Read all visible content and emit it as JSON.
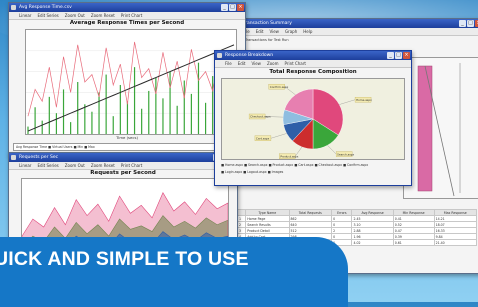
{
  "banner": {
    "text": "UICK AND SIMPLE TO USE"
  },
  "windows": {
    "avg_response": {
      "title": "Avg Response Time.csv",
      "menu": [
        "Linear",
        "Edit Series",
        "Zoom Out",
        "Zoom Reset",
        "Print Chart"
      ],
      "chart_title": "Average Response Times per Second",
      "xlabel": "Time (secs)",
      "legend": "Avg Response Time  ■ Virtual Users  ■ Min  ■ Max"
    },
    "requests": {
      "title": "Requests per Sec",
      "menu": [
        "Linear",
        "Edit Series",
        "Zoom Out",
        "Zoom Reset",
        "Print Chart"
      ],
      "chart_title": "Requests per Second",
      "legend": "Req/Sec  ■ Errors  ■ Virtual Users"
    },
    "transactions": {
      "title": "Transaction Summary",
      "menu": [
        "File",
        "Edit",
        "View",
        "Graph",
        "Help"
      ],
      "toolbar_label": "Test Transactions for Test Run",
      "columns": [
        "",
        "Type Name",
        "Total Requests",
        "Errors",
        "Avg Response",
        "Min Response",
        "Max Response"
      ],
      "rows": [
        [
          "1",
          "Home Page",
          "862",
          "0",
          "2.45",
          "0.41",
          "14.21"
        ],
        [
          "2",
          "Search Results",
          "640",
          "0",
          "3.10",
          "0.52",
          "18.07"
        ],
        [
          "3",
          "Product Detail",
          "512",
          "2",
          "2.88",
          "0.47",
          "16.33"
        ],
        [
          "4",
          "Add to Cart",
          "298",
          "0",
          "1.96",
          "0.39",
          "9.84"
        ],
        [
          "5",
          "Checkout",
          "174",
          "1",
          "4.02",
          "0.61",
          "21.40"
        ]
      ]
    },
    "response_breakdown": {
      "title": "Response Breakdown",
      "menu": [
        "File",
        "Edit",
        "View",
        "Zoom",
        "Print Chart"
      ],
      "chart_title": "Total Response Composition",
      "legend_line1": "■ Home.aspx  ■ Search.aspx  ■ Product.aspx  ■ Cart.aspx  ■ Checkout.aspx  ■ Confirm.aspx",
      "legend_line2": "■ Login.aspx  ■ Logout.aspx  ■ Images"
    }
  },
  "chart_data": [
    {
      "type": "pie",
      "title": "Total Response Composition",
      "slices": [
        {
          "label": "Home.aspx",
          "value": 34,
          "color": "#e0487c"
        },
        {
          "label": "Search.aspx",
          "value": 16,
          "color": "#3aa63a"
        },
        {
          "label": "Product.aspx",
          "value": 12,
          "color": "#cc2d2d"
        },
        {
          "label": "Cart.aspx",
          "value": 10,
          "color": "#2e5fa8"
        },
        {
          "label": "Checkout.aspx",
          "value": 8,
          "color": "#8fbde0"
        },
        {
          "label": "Confirm.aspx",
          "value": 20,
          "color": "#e77fb0"
        }
      ]
    },
    {
      "type": "line",
      "title": "Average Response Times per Second",
      "series": [
        {
          "name": "Avg Response Time",
          "color": "#e86a7a",
          "values": [
            12,
            30,
            22,
            45,
            18,
            52,
            28,
            60,
            35,
            40,
            25,
            58,
            33,
            47,
            20,
            62,
            38,
            44,
            27,
            55,
            31,
            49,
            24,
            57,
            36,
            42,
            29,
            53,
            21,
            46
          ]
        },
        {
          "name": "Virtual Users",
          "color": "#2b2b2b",
          "values": [
            2,
            4,
            6,
            8,
            10,
            12,
            14,
            16,
            18,
            20,
            22,
            24,
            26,
            28,
            30,
            32,
            34,
            36,
            38,
            40,
            42,
            44,
            46,
            48,
            50,
            52,
            54,
            56,
            58,
            60
          ]
        },
        {
          "name": "Requests",
          "color": "#3aa63a",
          "values": [
            5,
            18,
            9,
            25,
            14,
            30,
            8,
            35,
            20,
            15,
            28,
            40,
            12,
            33,
            22,
            45,
            17,
            29,
            38,
            24,
            42,
            19,
            36,
            27,
            48,
            21,
            39,
            31,
            44,
            26
          ]
        }
      ],
      "ylim": [
        0,
        70
      ]
    },
    {
      "type": "area",
      "title": "Requests per Second",
      "series": [
        {
          "name": "Req/Sec",
          "color": "#e0487c",
          "values": [
            20,
            35,
            28,
            45,
            30,
            52,
            38,
            48,
            33,
            55,
            40,
            47,
            36,
            58,
            42,
            50,
            39,
            53,
            44,
            49
          ]
        },
        {
          "name": "Errors",
          "color": "#2e5fa8",
          "values": [
            5,
            12,
            8,
            16,
            10,
            20,
            14,
            18,
            11,
            22,
            15,
            19,
            13,
            24,
            17,
            21,
            16,
            23,
            18,
            20
          ]
        },
        {
          "name": "Virtual Users",
          "color": "#3aa63a",
          "values": [
            10,
            20,
            15,
            28,
            18,
            32,
            22,
            30,
            20,
            35,
            26,
            29,
            24,
            38,
            28,
            33,
            27,
            36,
            30,
            34
          ]
        }
      ],
      "ylim": [
        0,
        70
      ]
    }
  ]
}
